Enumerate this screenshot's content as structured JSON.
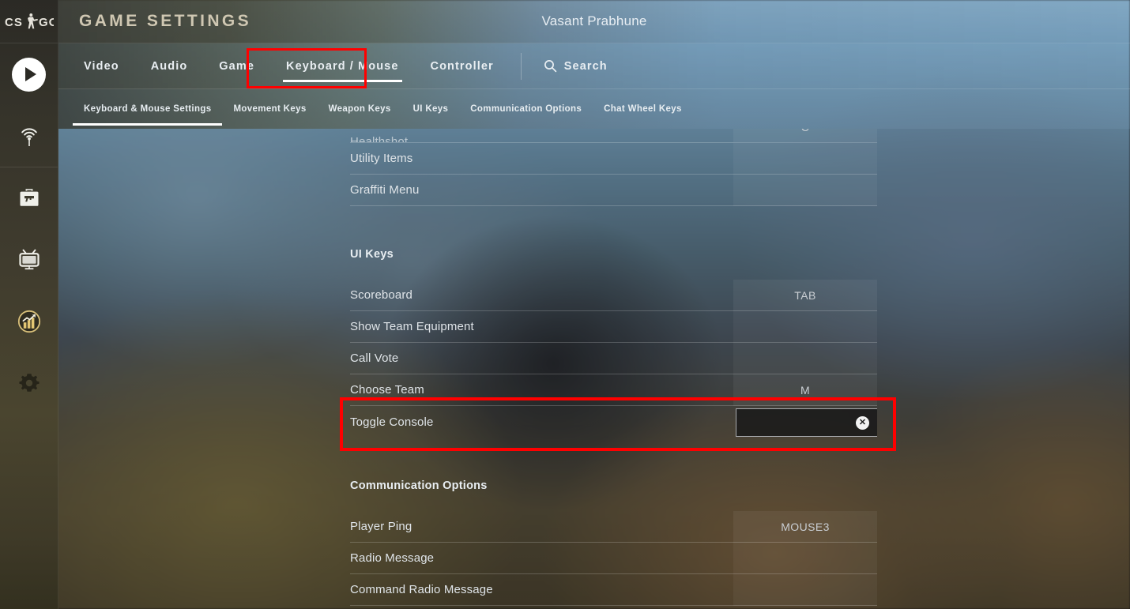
{
  "app": {
    "logo_text_left": "CS",
    "logo_text_right": "GO",
    "page_title": "GAME SETTINGS",
    "persona_name": "Vasant Prabhune"
  },
  "sidebar": {
    "items": [
      {
        "label": "Play",
        "icon": "play-icon"
      },
      {
        "label": "Watch",
        "icon": "broadcast-icon"
      },
      {
        "label": "Inventory",
        "icon": "briefcase-icon"
      },
      {
        "label": "Tune In",
        "icon": "tv-icon"
      },
      {
        "label": "Stats",
        "icon": "stats-icon"
      },
      {
        "label": "Settings",
        "icon": "gear-icon"
      }
    ]
  },
  "tabs": {
    "items": [
      {
        "label": "Video",
        "active": false
      },
      {
        "label": "Audio",
        "active": false
      },
      {
        "label": "Game",
        "active": false
      },
      {
        "label": "Keyboard / Mouse",
        "active": true
      },
      {
        "label": "Controller",
        "active": false
      }
    ],
    "search_label": "Search",
    "search_icon": "search-icon"
  },
  "subtabs": {
    "items": [
      {
        "label": "Keyboard & Mouse Settings",
        "active": true
      },
      {
        "label": "Movement Keys",
        "active": false
      },
      {
        "label": "Weapon Keys",
        "active": false
      },
      {
        "label": "UI Keys",
        "active": false
      },
      {
        "label": "Communication Options",
        "active": false
      },
      {
        "label": "Chat Wheel Keys",
        "active": false
      }
    ]
  },
  "settings": {
    "clipped_row": {
      "label": "Healthshot",
      "key": "C"
    },
    "top_rows": [
      {
        "label": "Utility Items",
        "key": ""
      },
      {
        "label": "Graffiti Menu",
        "key": ""
      }
    ],
    "sections": [
      {
        "title": "UI Keys",
        "rows": [
          {
            "label": "Scoreboard",
            "key": "TAB",
            "type": "value"
          },
          {
            "label": "Show Team Equipment",
            "key": "",
            "type": "value"
          },
          {
            "label": "Call Vote",
            "key": "",
            "type": "value"
          },
          {
            "label": "Choose Team",
            "key": "M",
            "type": "value"
          },
          {
            "label": "Toggle Console",
            "key": "",
            "type": "input",
            "input_value": "",
            "clear_icon": "clear-x-icon"
          }
        ]
      },
      {
        "title": "Communication Options",
        "rows": [
          {
            "label": "Player Ping",
            "key": "MOUSE3",
            "type": "value"
          },
          {
            "label": "Radio Message",
            "key": "",
            "type": "value"
          },
          {
            "label": "Command Radio Message",
            "key": "",
            "type": "value"
          }
        ]
      }
    ]
  },
  "annotations": {
    "highlight_color": "#ff0000",
    "tab_highlight_target": "Keyboard / Mouse",
    "row_highlight_target": "Toggle Console"
  }
}
